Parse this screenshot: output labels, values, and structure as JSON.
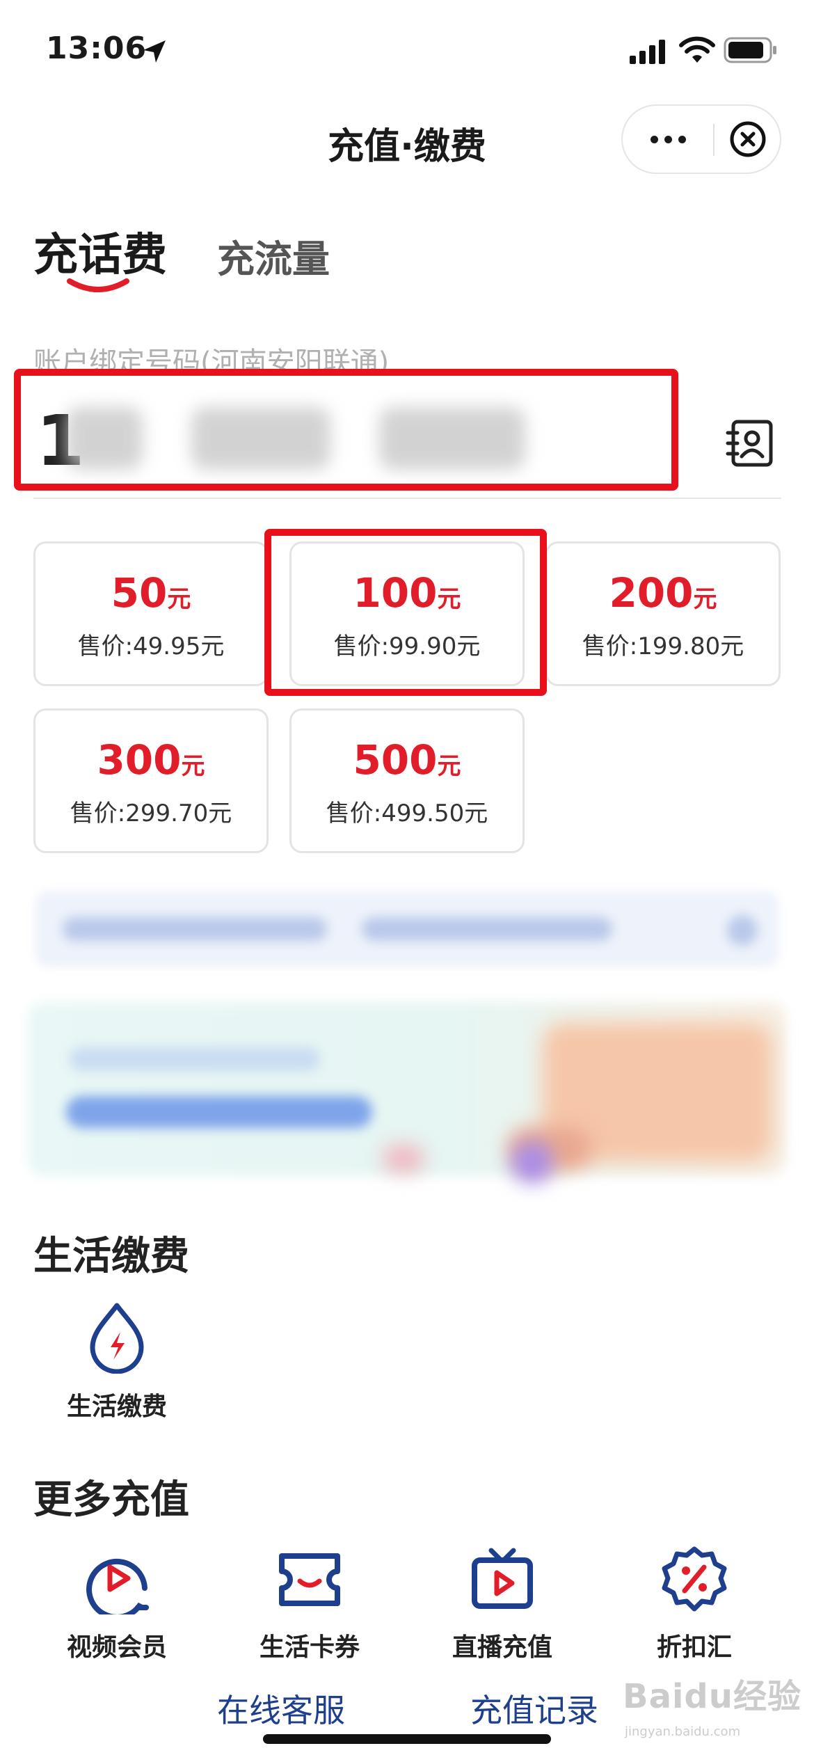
{
  "status_bar": {
    "time": "13:06"
  },
  "nav": {
    "title": "充值·缴费"
  },
  "tabs": [
    {
      "label": "充话费",
      "active": true
    },
    {
      "label": "充流量",
      "active": false
    }
  ],
  "account": {
    "label": "账户绑定号码(河南安阳联通)",
    "phone_visible_prefix": "1"
  },
  "amount_options": [
    {
      "amount": "50",
      "unit": "元",
      "price": "售价:49.95元"
    },
    {
      "amount": "100",
      "unit": "元",
      "price": "售价:99.90元",
      "selected": true
    },
    {
      "amount": "200",
      "unit": "元",
      "price": "售价:199.80元"
    },
    {
      "amount": "300",
      "unit": "元",
      "price": "售价:299.70元"
    },
    {
      "amount": "500",
      "unit": "元",
      "price": "售价:499.50元"
    }
  ],
  "life_payment": {
    "title": "生活缴费",
    "items": [
      {
        "label": "生活缴费",
        "icon": "water-drop-bolt-icon"
      }
    ]
  },
  "more_recharge": {
    "title": "更多充值",
    "items": [
      {
        "label": "视频会员",
        "icon": "video-play-icon"
      },
      {
        "label": "生活卡券",
        "icon": "coupon-ticket-icon"
      },
      {
        "label": "直播充值",
        "icon": "tv-live-icon"
      },
      {
        "label": "折扣汇",
        "icon": "percent-badge-icon"
      }
    ]
  },
  "bottom_links": {
    "service": "在线客服",
    "records": "充值记录"
  },
  "watermark": {
    "text": "Baidu经验",
    "sub": "jingyan.baidu.com"
  },
  "colors": {
    "accent_red": "#e11d2a",
    "highlight_red": "#e8101a",
    "icon_navy": "#1e3e8e",
    "link_blue": "#1e3e8e"
  }
}
